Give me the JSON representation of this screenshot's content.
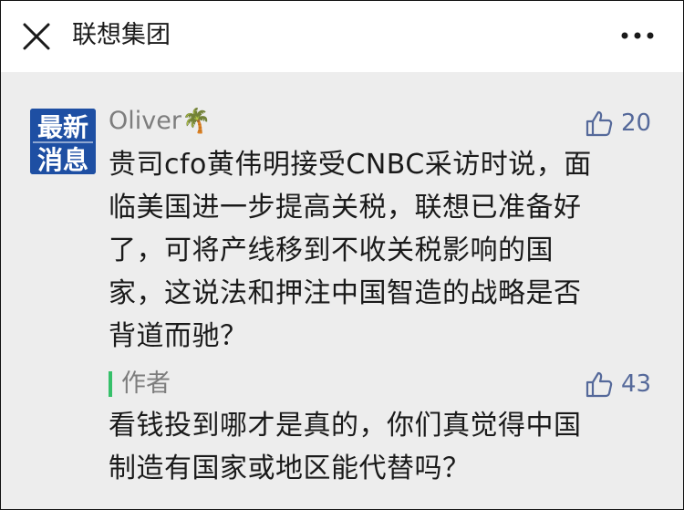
{
  "header": {
    "title": "联想集团"
  },
  "comment": {
    "nickname": "Oliver",
    "nickname_emoji": "🌴",
    "avatar_text": [
      "最新",
      "消息"
    ],
    "likes": "20",
    "lines": [
      "贵司cfo黄伟明接受CNBC采访时说，面",
      "临美国进一步提高关税，联想已准备好",
      "了，可将产线移到不收关税影响的国",
      "家，这说法和押注中国智造的战略是否",
      "背道而驰？"
    ]
  },
  "reply": {
    "author": "作者",
    "likes": "43",
    "lines": [
      "看钱投到哪才是真的，你们真觉得中国",
      "制造有国家或地区能代替吗？"
    ]
  },
  "colors": {
    "background": "#ededed",
    "header_bg": "#ffffff",
    "like_blue": "#55699a",
    "reply_bar_green": "#36c06a",
    "avatar_blue": "#1e4fa3"
  },
  "icons": [
    "close-icon",
    "more-icon",
    "thumbs-up-icon"
  ]
}
